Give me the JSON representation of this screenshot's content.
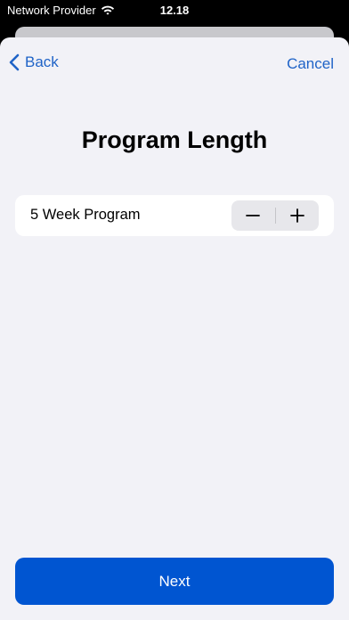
{
  "status_bar": {
    "provider": "Network Provider",
    "time": "12.18",
    "wifi_icon": "wifi-icon"
  },
  "nav": {
    "back_label": "Back",
    "back_icon": "chevron-left-icon",
    "cancel_label": "Cancel"
  },
  "page": {
    "title": "Program Length"
  },
  "program": {
    "label": "5 Week Program",
    "decrement_icon": "minus-icon",
    "increment_icon": "plus-icon"
  },
  "footer": {
    "next_label": "Next"
  },
  "colors": {
    "accent": "#1f63c7",
    "primary_button": "#0055d1",
    "sheet_background": "#f2f2f7",
    "row_background": "#ffffff"
  }
}
